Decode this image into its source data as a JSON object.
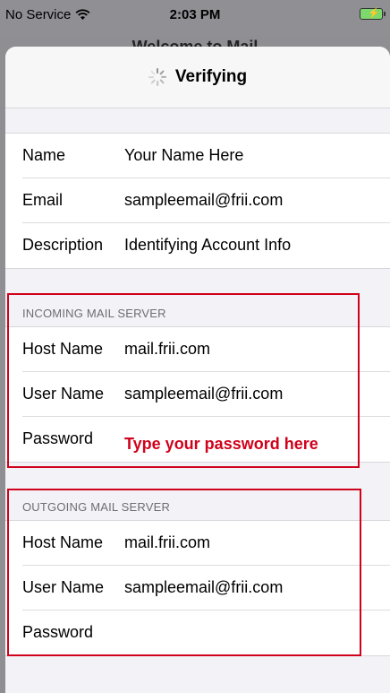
{
  "status_bar": {
    "carrier": "No Service",
    "time": "2:03 PM"
  },
  "background_title": "Welcome to Mail",
  "nav": {
    "title": "Verifying"
  },
  "account": [
    {
      "label": "Name",
      "value": "Your Name Here"
    },
    {
      "label": "Email",
      "value": "sampleemail@frii.com"
    },
    {
      "label": "Description",
      "value": "Identifying Account Info"
    }
  ],
  "incoming": {
    "header": "INCOMING MAIL SERVER",
    "rows": [
      {
        "label": "Host Name",
        "value": "mail.frii.com"
      },
      {
        "label": "User Name",
        "value": "sampleemail@frii.com"
      },
      {
        "label": "Password",
        "value": "Type your password here"
      }
    ]
  },
  "outgoing": {
    "header": "OUTGOING MAIL SERVER",
    "rows": [
      {
        "label": "Host Name",
        "value": "mail.frii.com"
      },
      {
        "label": "User Name",
        "value": "sampleemail@frii.com"
      },
      {
        "label": "Password",
        "value": ""
      }
    ]
  },
  "colors": {
    "annotation": "#d0021b"
  }
}
